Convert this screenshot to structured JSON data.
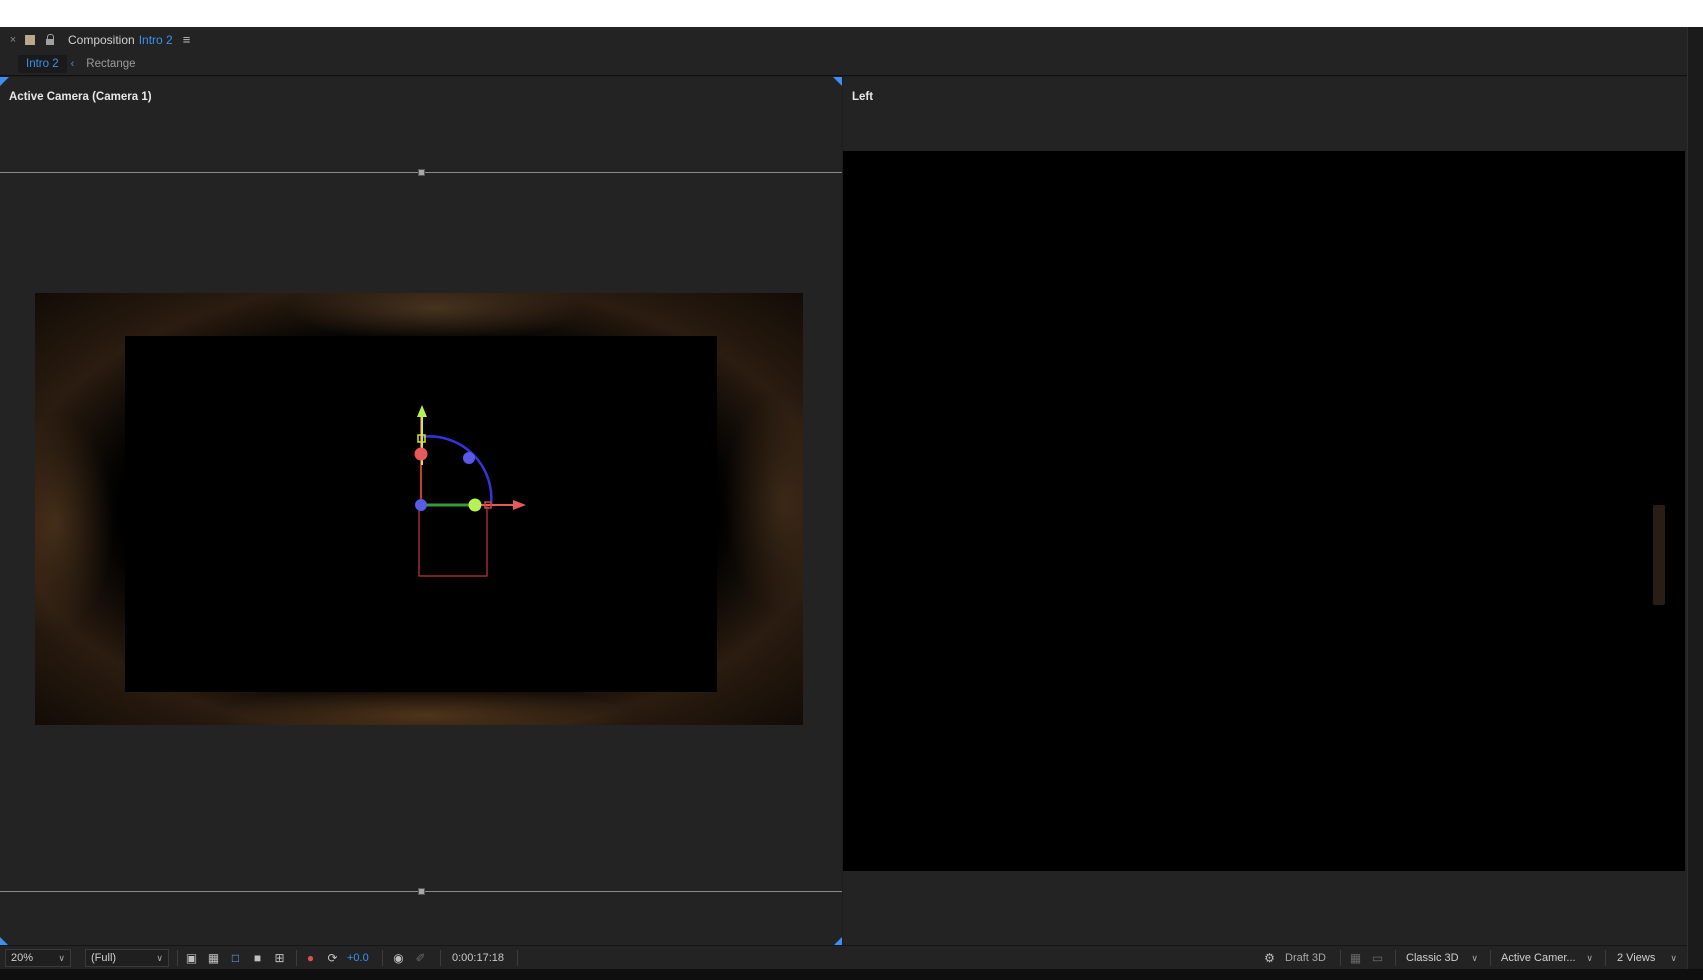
{
  "panel": {
    "close": "×",
    "title_prefix": "Composition",
    "title_comp": "Intro 2",
    "menu": "≡"
  },
  "breadcrumbs": {
    "active": "Intro 2",
    "arrow": "‹",
    "next": "Rectange"
  },
  "views": {
    "left_label": "Active Camera (Camera 1)",
    "right_label": "Left"
  },
  "footer": {
    "zoom": "20%",
    "resolution": "(Full)",
    "exposure": "+0.0",
    "timecode": "0:00:17:18",
    "draft3d": "Draft 3D",
    "renderer": "Classic 3D",
    "camera_view": "Active Camer...",
    "views_layout": "2 Views"
  },
  "colors": {
    "accent": "#3d8ff0",
    "panel_bg": "#232323",
    "axis_x": "#e8595a",
    "axis_y": "#b6f255",
    "axis_z": "#5a5ae6"
  },
  "icons": [
    "close-icon",
    "lock-icon",
    "menu-icon",
    "chevron-left-icon",
    "snapshot-icon",
    "color-channel-icon",
    "reset-exposure-icon",
    "draft3d-icon"
  ]
}
